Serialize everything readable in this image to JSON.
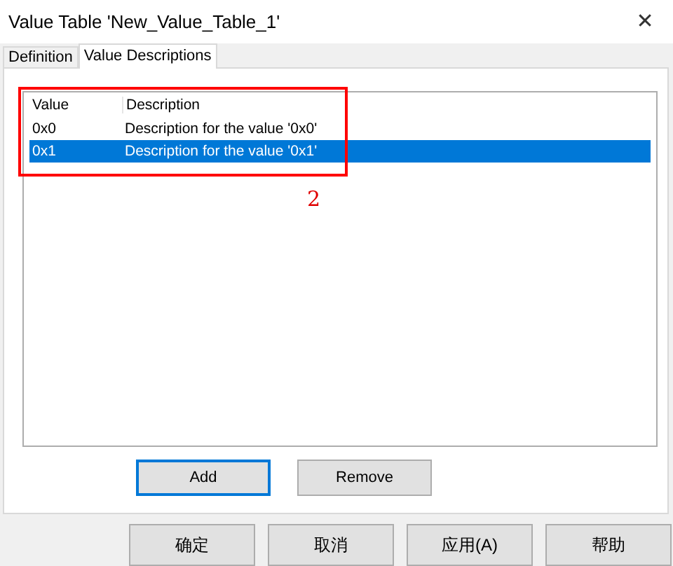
{
  "window": {
    "title": "Value Table 'New_Value_Table_1'",
    "close": "✕"
  },
  "tabs": [
    {
      "label": "Definition",
      "selected": false
    },
    {
      "label": "Value Descriptions",
      "selected": true
    }
  ],
  "table": {
    "columns": [
      "Value",
      "Description"
    ],
    "rows": [
      {
        "cells": [
          "0x0",
          "Description for the value '0x0'"
        ],
        "selected": false
      },
      {
        "cells": [
          "0x1",
          "Description for the value '0x1'"
        ],
        "selected": true
      }
    ]
  },
  "annotation": {
    "label": "2"
  },
  "list_buttons": [
    {
      "label": "Add",
      "focused": true
    },
    {
      "label": "Remove",
      "focused": false
    }
  ],
  "buttons": [
    "确定",
    "取消",
    "应用(A)",
    "帮助"
  ]
}
